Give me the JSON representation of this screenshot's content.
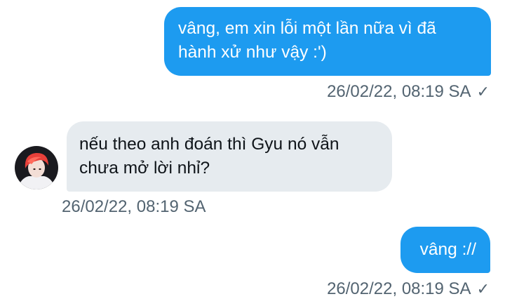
{
  "colors": {
    "accent": "#1d9bf0",
    "incoming_bubble": "#e6ebef",
    "meta_text": "#536471",
    "avatar_hair": "#e8403a"
  },
  "messages": [
    {
      "direction": "outgoing",
      "text": "vâng, em xin lỗi một lần nữa vì đã\nhành xử như vậy :')",
      "timestamp": "26/02/22, 08:19 SA",
      "status_icon": "check-icon",
      "status_glyph": "✓"
    },
    {
      "direction": "incoming",
      "text": "nếu theo anh đoán thì Gyu nó vẫn\nchưa mở lời nhỉ?",
      "timestamp": "26/02/22, 08:19 SA",
      "avatar_icon": "avatar"
    },
    {
      "direction": "outgoing",
      "text": "vâng ://",
      "timestamp": "26/02/22, 08:19 SA",
      "status_icon": "check-icon",
      "status_glyph": "✓"
    }
  ]
}
